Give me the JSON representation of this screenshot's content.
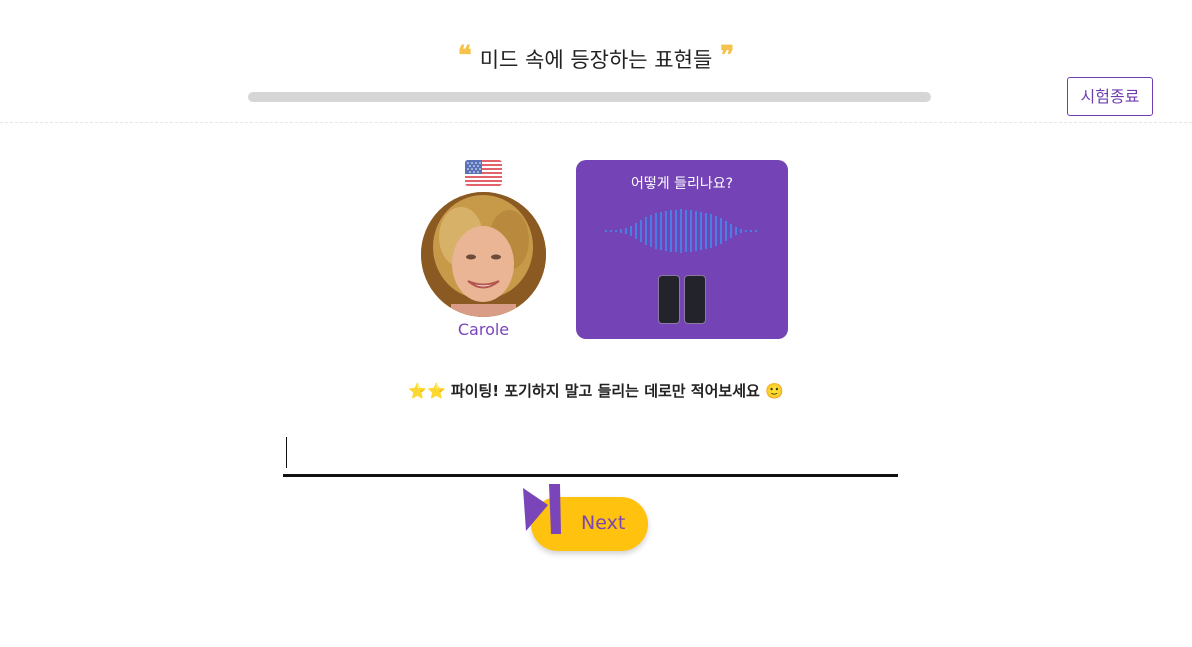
{
  "header": {
    "title": "미드 속에 등장하는 표현들",
    "open_quote": "❝",
    "close_quote": "❞",
    "end_button_label": "시험종료",
    "progress_fraction": 0.0,
    "accent_color": "#7a45b8"
  },
  "speaker": {
    "name": "Carole",
    "flag_icon": "us-flag-icon",
    "avatar_icon": "speaker-avatar"
  },
  "audio_card": {
    "question": "어떻게 들리나요?",
    "wave_icon": "audio-wave-icon",
    "pause_icon": "pause-icon",
    "background_color": "#7444b6"
  },
  "hint": {
    "stars": "⭐⭐",
    "text": "파이팅! 포기하지 말고 들리는 데로만 적어보세요 🙂"
  },
  "answer": {
    "value": "",
    "placeholder": ""
  },
  "next": {
    "label": "Next",
    "icon": "skip-next-icon",
    "button_color": "#ffc20e"
  }
}
